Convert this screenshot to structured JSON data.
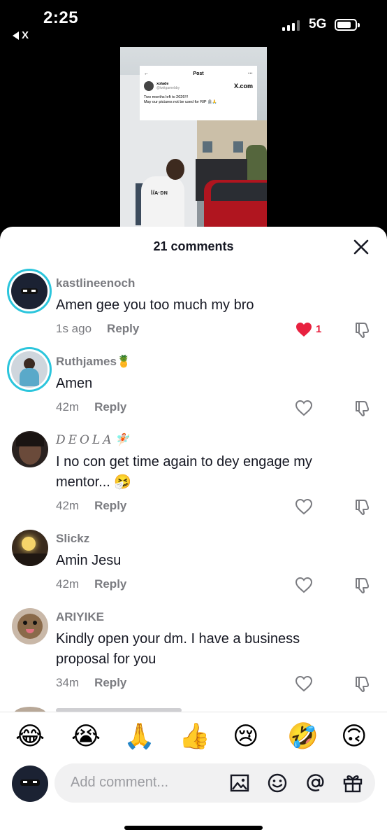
{
  "status_bar": {
    "time": "2:25",
    "back_label": "X",
    "network": "5G"
  },
  "video": {
    "tweet": {
      "header": "Post",
      "more": "···",
      "name": "xolade",
      "handle": "@twitgamebby",
      "site": "X.com",
      "line1": "Two months left to 2026!!!",
      "line2": "May our pictures not be used for RIP 🪦🙏"
    },
    "shirt_text": "I/ᴀ·ᴅɴ"
  },
  "sheet": {
    "title": "21 comments",
    "comments": [
      {
        "username": "kastlineenoch",
        "text": "Amen gee you too much my bro",
        "time": "1s ago",
        "reply": "Reply",
        "liked": true,
        "likes": "1"
      },
      {
        "username": "Ruthjames🍍",
        "text": "Amen",
        "time": "42m",
        "reply": "Reply",
        "liked": false
      },
      {
        "username": "𝐷𝐸𝑂𝐿𝐴🧚🏻",
        "text": "I no con get time again to dey engage my mentor... 🤧",
        "time": "42m",
        "reply": "Reply",
        "liked": false
      },
      {
        "username": "Slickz",
        "text": "Amin Jesu",
        "time": "42m",
        "reply": "Reply",
        "liked": false
      },
      {
        "username": "ARIYIKE",
        "text": "Kindly open your dm. I have a business proposal for you",
        "time": "34m",
        "reply": "Reply",
        "liked": false
      }
    ]
  },
  "emoji_bar": [
    "😂",
    "😭",
    "🙏",
    "👍",
    "😢",
    "🤣",
    "🙃"
  ],
  "comment_input": {
    "placeholder": "Add comment..."
  },
  "colors": {
    "like_red": "#e8213f",
    "ring_cyan": "#2bc5dc",
    "muted_text": "#7a7b80"
  }
}
